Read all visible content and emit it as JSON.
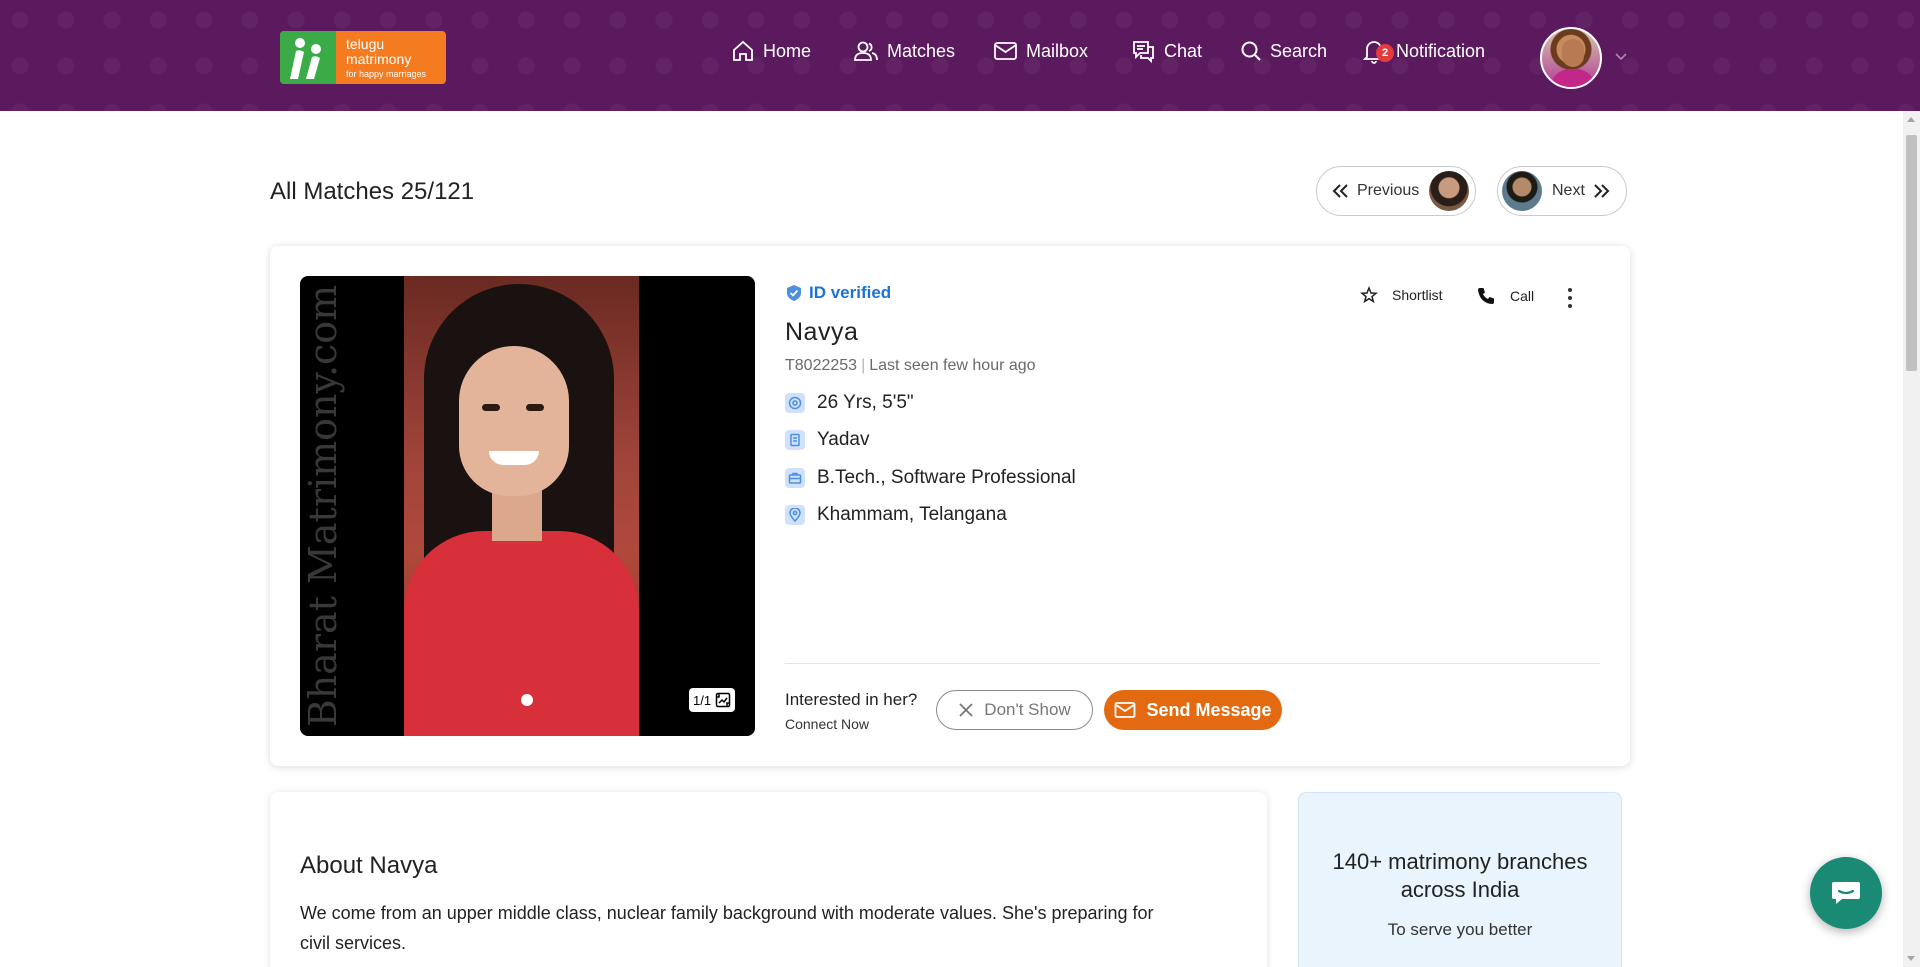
{
  "header": {
    "logo": {
      "line1": "telugu",
      "line2": "matrimony",
      "tagline": "for happy marriages"
    },
    "nav": {
      "home": "Home",
      "matches": "Matches",
      "mailbox": "Mailbox",
      "chat": "Chat",
      "search": "Search",
      "notification": "Notification",
      "notification_count": "2"
    },
    "accent": "#5b1a5e"
  },
  "page": {
    "title": "All Matches 25/121",
    "previous_label": "Previous",
    "next_label": "Next"
  },
  "profile": {
    "verified_label": "ID verified",
    "name": "Navya",
    "profile_id": "T8022253",
    "last_seen": "Last seen few hour ago",
    "age_height": "26 Yrs, 5'5\"",
    "caste": "Yadav",
    "education_job": "B.Tech., Software Professional",
    "location": "Khammam, Telangana",
    "photo_count": "1/1",
    "watermark": "Bharat Matrimony.com",
    "shortlist_label": "Shortlist",
    "call_label": "Call",
    "interest_question": "Interested in her?",
    "interest_sub": "Connect Now",
    "dont_show_label": "Don't Show",
    "send_message_label": "Send Message",
    "send_color": "#e46a12",
    "verified_color": "#1e73d6"
  },
  "about": {
    "title": "About Navya",
    "text": "We come from an upper middle class, nuclear family background with moderate values. She's preparing for civil services."
  },
  "promo": {
    "title": "140+ matrimony branches across India",
    "subtitle": "To serve you better"
  }
}
